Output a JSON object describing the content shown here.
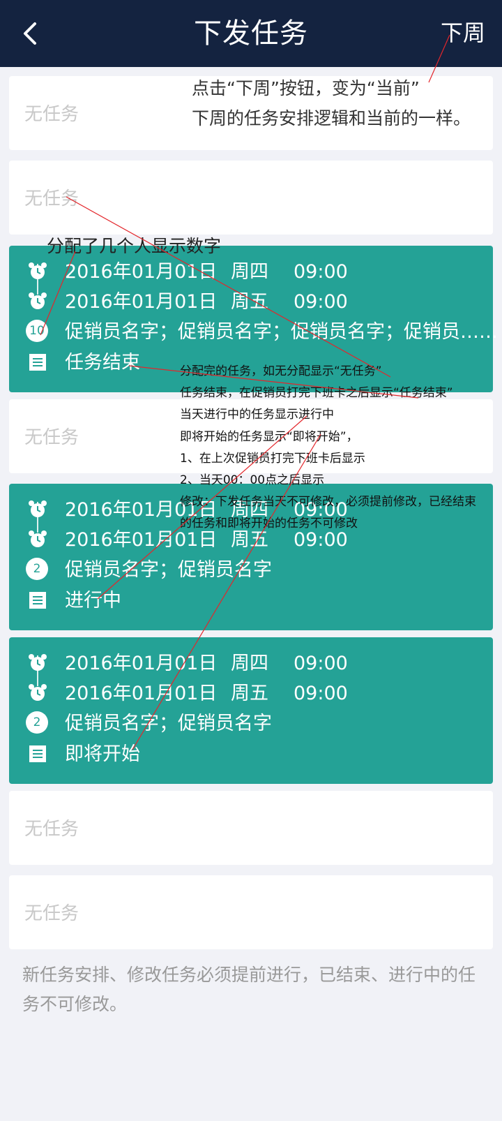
{
  "header": {
    "title": "下发任务",
    "next_week_label": "下周"
  },
  "empty_label": "无任务",
  "tasks": [
    {
      "start_date": "2016年01月01日",
      "start_week": "周四",
      "start_time": "09:00",
      "end_date": "2016年01月01日",
      "end_week": "周五",
      "end_time": "09:00",
      "count": "10",
      "promoters": "促销员名字；促销员名字；促销员名字；促销员……",
      "status": "任务结束"
    },
    {
      "start_date": "2016年01月01日",
      "start_week": "周四",
      "start_time": "09:00",
      "end_date": "2016年01月01日",
      "end_week": "周五",
      "end_time": "09:00",
      "count": "2",
      "promoters": "促销员名字；促销员名字",
      "status": "进行中"
    },
    {
      "start_date": "2016年01月01日",
      "start_week": "周四",
      "start_time": "09:00",
      "end_date": "2016年01月01日",
      "end_week": "周五",
      "end_time": "09:00",
      "count": "2",
      "promoters": "促销员名字；促销员名字",
      "status": "即将开始"
    }
  ],
  "annotations": {
    "next_week_note_1": "点击“下周”按钮，变为“当前”",
    "next_week_note_2": "下周的任务安排逻辑和当前的一样。",
    "count_note": "分配了几个人显示数字",
    "rules": [
      "分配完的任务，如无分配显示“无任务”",
      "任务结束，在促销员打完下班卡之后显示“任务结束”",
      "当天进行中的任务显示进行中",
      "即将开始的任务显示“即将开始”，",
      "1、在上次促销员打完下班卡后显示",
      "2、当天00：00点之后显示",
      "修改：下发任务当天不可修改，必须提前修改，已经结束",
      "的任务和即将开始的任务不可修改"
    ]
  },
  "footer_note": "新任务安排、修改任务必须提前进行，已结束、进行中的任务不可修改。",
  "colors": {
    "header_bg": "#142340",
    "task_card_bg": "#24a296",
    "page_bg": "#f1f2f7",
    "annotation_line": "#e3262b"
  }
}
